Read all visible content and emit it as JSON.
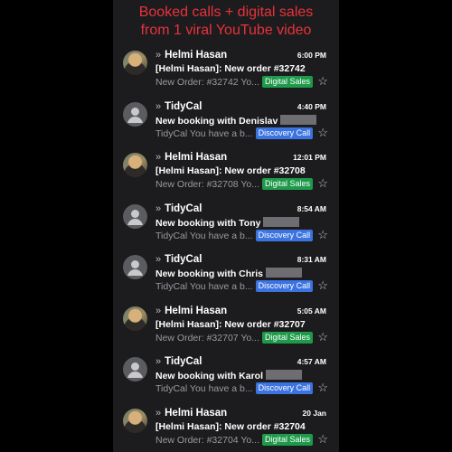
{
  "header": {
    "line1": "Booked calls + digital sales",
    "line2": "from 1 viral YouTube video"
  },
  "colors": {
    "header_red": "#e8323b",
    "badge_green": "#1e9a4a",
    "badge_blue": "#3b73e0"
  },
  "emails": [
    {
      "sender": "Helmi Hasan",
      "time": "6:00 PM",
      "subject": "[Helmi Hasan]: New order #32742",
      "preview": "New Order: #32742 Yo...",
      "badge": "Digital Sales",
      "avatar": "photo"
    },
    {
      "sender": "TidyCal",
      "time": "4:40 PM",
      "subject": "New booking with Denislav",
      "preview": "TidyCal You have a b...",
      "badge": "Discovery Call",
      "avatar": "generic"
    },
    {
      "sender": "Helmi Hasan",
      "time": "12:01 PM",
      "subject": "[Helmi Hasan]: New order #32708",
      "preview": "New Order: #32708 Yo...",
      "badge": "Digital Sales",
      "avatar": "photo"
    },
    {
      "sender": "TidyCal",
      "time": "8:54 AM",
      "subject": "New booking with Tony",
      "preview": "TidyCal You have a b...",
      "badge": "Discovery Call",
      "avatar": "generic"
    },
    {
      "sender": "TidyCal",
      "time": "8:31 AM",
      "subject": "New booking with Chris",
      "preview": "TidyCal You have a b...",
      "badge": "Discovery Call",
      "avatar": "generic"
    },
    {
      "sender": "Helmi Hasan",
      "time": "5:05 AM",
      "subject": "[Helmi Hasan]: New order #32707",
      "preview": "New Order: #32707 Yo...",
      "badge": "Digital Sales",
      "avatar": "photo"
    },
    {
      "sender": "TidyCal",
      "time": "4:57 AM",
      "subject": "New booking with Karol",
      "preview": "TidyCal You have a b...",
      "badge": "Discovery Call",
      "avatar": "generic"
    },
    {
      "sender": "Helmi Hasan",
      "time": "20 Jan",
      "subject": "[Helmi Hasan]: New order #32704",
      "preview": "New Order: #32704 Yo...",
      "badge": "Digital Sales",
      "avatar": "photo"
    }
  ],
  "icons": {
    "forward": "chevron-double-right-icon",
    "star": "star-outline-icon",
    "avatar_generic": "person-icon"
  }
}
